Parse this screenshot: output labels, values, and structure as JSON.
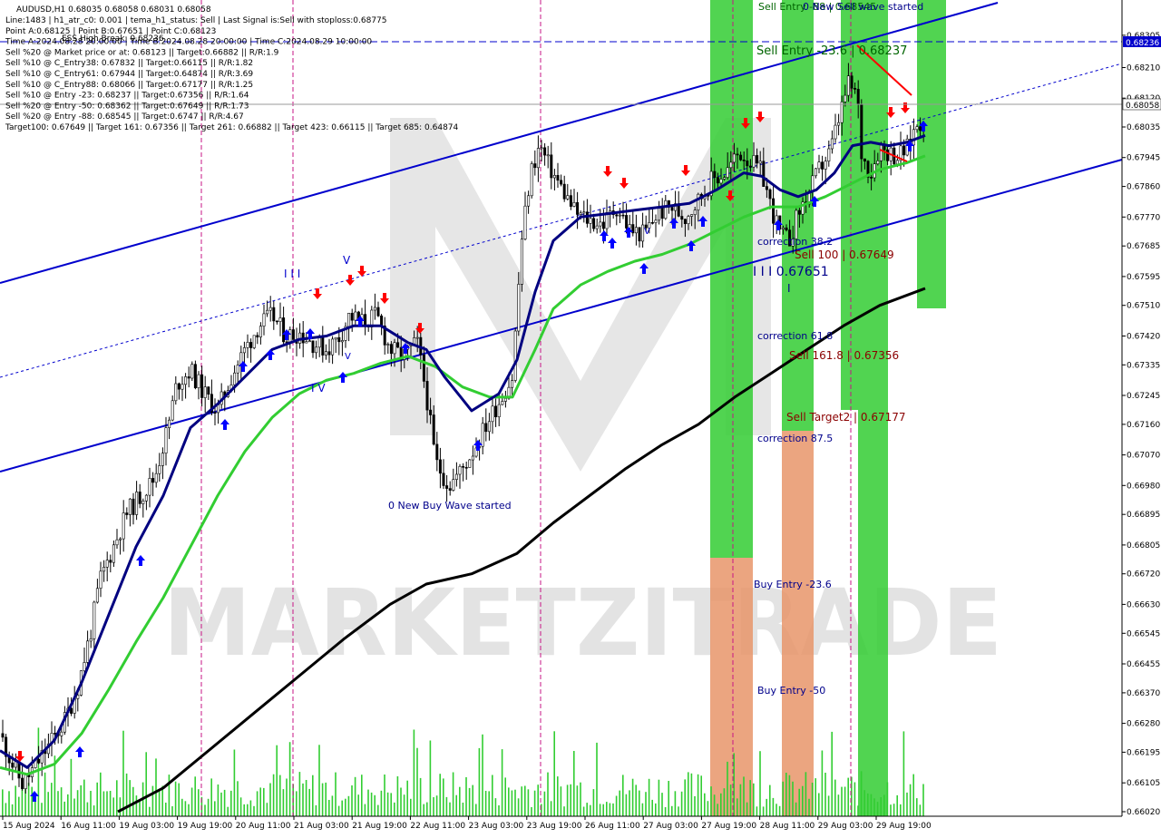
{
  "header": {
    "symbol_line": "AUDUSD,H1  0.68035 0.68058 0.68031 0.68058",
    "info_lines": [
      "Line:1483 | h1_atr_c0: 0.001 | tema_h1_status: Sell | Last Signal is:Sell with stoploss:0.68775",
      "Point A:0.68125 | Point B:0.67651 | Point C:0.68123",
      "Time A:2024.08.28 20:00:00 | Time B:2024.08.28 20:00:00 | Time C:2024.08.29 10:00:00",
      "Sell %20 @ Market price or at: 0.68123 || Target:0.66882 || R/R:1.9",
      "Sell %10 @ C_Entry38: 0.67832 || Target:0.66115 || R/R:1.82",
      "Sell %10 @ C_Entry61: 0.67944 || Target:0.64874 || R/R:3.69",
      "Sell %10 @ C_Entry88: 0.68066 || Target:0.67177 || R/R:1.25",
      "Sell %10 @ Entry -23: 0.68237 || Target:0.67356 || R/R:1.64",
      "Sell %20 @ Entry -50: 0.68362 || Target:0.67649 || R/R:1.73",
      "Sell %20 @ Entry -88: 0.68545 || Target:0.6747 || R/R:4.67",
      "Target100: 0.67649 || Target 161: 0.67356 || Target 261: 0.66882 || Target 423: 0.66115 || Target 685: 0.64874"
    ],
    "overlap_label": "ESS High Break: 0.68236"
  },
  "colors": {
    "candle": "#000000",
    "ema_fast": "#000080",
    "ema_mid": "#32cd32",
    "ema_slow": "#000000",
    "channel": "#0000cd",
    "volume": "#32cd32",
    "zone_green": "#32cd32",
    "zone_orange": "#e8956a",
    "buy_arrow": "#0000ff",
    "sell_arrow": "#ff0000",
    "price_tag": "#0000cd"
  },
  "annotations": {
    "sell_entry_top": "Sell Entry -88 | 0.68545",
    "new_sell_wave": "0 New Sell wave started",
    "sell_entry_mid": "Sell Entry -23.6 | 0.68237",
    "correction_382": "correction 38.2",
    "sell_100": "Sell 100 | 0.67649",
    "point_b": "I I I 0.67651",
    "point_b_tick": "I",
    "correction_618": "correction 61.8",
    "sell_1618": "Sell 161.8 | 0.67356",
    "sell_target2": "Sell Target2 | 0.67177",
    "correction_875": "correction 87.5",
    "buy_entry_236": "Buy Entry -23.6",
    "buy_entry_50": "Buy Entry -50",
    "new_buy_wave": "0 New Buy Wave started",
    "roman_iii": "I I I",
    "roman_v": "V",
    "roman_iv": "I V",
    "small_v": "V",
    "small_v2": "V"
  },
  "watermark": "MARKETZITRADE",
  "price_axis": {
    "current_price": "0.68058",
    "high_break_price": "0.68236",
    "ticks": [
      "0.68305",
      "0.68210",
      "0.68120",
      "0.68035",
      "0.67945",
      "0.67860",
      "0.67770",
      "0.67685",
      "0.67595",
      "0.67510",
      "0.67420",
      "0.67335",
      "0.67245",
      "0.67160",
      "0.67070",
      "0.66980",
      "0.66895",
      "0.66805",
      "0.66720",
      "0.66630",
      "0.66545",
      "0.66455",
      "0.66370",
      "0.66280",
      "0.66195",
      "0.66105",
      "0.66020"
    ]
  },
  "time_axis": {
    "labels": [
      "15 Aug 2024",
      "16 Aug 11:00",
      "19 Aug 03:00",
      "19 Aug 19:00",
      "20 Aug 11:00",
      "21 Aug 03:00",
      "21 Aug 19:00",
      "22 Aug 11:00",
      "23 Aug 03:00",
      "23 Aug 19:00",
      "26 Aug 11:00",
      "27 Aug 03:00",
      "27 Aug 19:00",
      "28 Aug 11:00",
      "29 Aug 03:00",
      "29 Aug 19:00"
    ]
  },
  "chart_data": {
    "type": "candlestick",
    "symbol": "AUDUSD",
    "timeframe": "H1",
    "ylim": [
      0.6602,
      0.6835
    ],
    "close_path": [
      [
        0,
        0.6625
      ],
      [
        12,
        0.6617
      ],
      [
        25,
        0.661
      ],
      [
        38,
        0.6615
      ],
      [
        55,
        0.6622
      ],
      [
        70,
        0.6628
      ],
      [
        85,
        0.6638
      ],
      [
        100,
        0.6655
      ],
      [
        110,
        0.667
      ],
      [
        125,
        0.668
      ],
      [
        140,
        0.669
      ],
      [
        155,
        0.6695
      ],
      [
        170,
        0.67
      ],
      [
        185,
        0.6715
      ],
      [
        195,
        0.6728
      ],
      [
        210,
        0.6732
      ],
      [
        225,
        0.6725
      ],
      [
        240,
        0.672
      ],
      [
        255,
        0.673
      ],
      [
        270,
        0.6738
      ],
      [
        285,
        0.6745
      ],
      [
        300,
        0.6748
      ],
      [
        315,
        0.6742
      ],
      [
        330,
        0.6743
      ],
      [
        345,
        0.674
      ],
      [
        360,
        0.6738
      ],
      [
        375,
        0.6742
      ],
      [
        385,
        0.6748
      ],
      [
        400,
        0.6746
      ],
      [
        415,
        0.6748
      ],
      [
        430,
        0.6738
      ],
      [
        445,
        0.6736
      ],
      [
        460,
        0.674
      ],
      [
        470,
        0.6725
      ],
      [
        480,
        0.6705
      ],
      [
        495,
        0.6698
      ],
      [
        510,
        0.6703
      ],
      [
        525,
        0.671
      ],
      [
        540,
        0.6718
      ],
      [
        555,
        0.6725
      ],
      [
        565,
        0.673
      ],
      [
        575,
        0.677
      ],
      [
        585,
        0.679
      ],
      [
        595,
        0.6798
      ],
      [
        605,
        0.6792
      ],
      [
        620,
        0.6785
      ],
      [
        635,
        0.6778
      ],
      [
        650,
        0.6776
      ],
      [
        665,
        0.6775
      ],
      [
        680,
        0.678
      ],
      [
        695,
        0.6773
      ],
      [
        710,
        0.6772
      ],
      [
        725,
        0.6778
      ],
      [
        740,
        0.678
      ],
      [
        755,
        0.6777
      ],
      [
        770,
        0.6782
      ],
      [
        785,
        0.6788
      ],
      [
        800,
        0.679
      ],
      [
        815,
        0.6796
      ],
      [
        825,
        0.6794
      ],
      [
        840,
        0.679
      ],
      [
        850,
        0.678
      ],
      [
        860,
        0.6772
      ],
      [
        870,
        0.677
      ],
      [
        880,
        0.6778
      ],
      [
        895,
        0.6786
      ],
      [
        905,
        0.6792
      ],
      [
        915,
        0.6796
      ],
      [
        925,
        0.6806
      ],
      [
        935,
        0.6816
      ],
      [
        945,
        0.6813
      ],
      [
        950,
        0.6795
      ],
      [
        960,
        0.679
      ],
      [
        970,
        0.6798
      ],
      [
        980,
        0.6796
      ],
      [
        990,
        0.6795
      ],
      [
        1000,
        0.6797
      ],
      [
        1010,
        0.6804
      ],
      [
        1020,
        0.68058
      ]
    ],
    "ema_fast": [
      [
        0,
        0.662
      ],
      [
        30,
        0.6615
      ],
      [
        60,
        0.6623
      ],
      [
        90,
        0.664
      ],
      [
        120,
        0.666
      ],
      [
        150,
        0.668
      ],
      [
        180,
        0.6695
      ],
      [
        210,
        0.6715
      ],
      [
        240,
        0.6722
      ],
      [
        270,
        0.673
      ],
      [
        300,
        0.6738
      ],
      [
        330,
        0.6741
      ],
      [
        360,
        0.6742
      ],
      [
        390,
        0.6745
      ],
      [
        420,
        0.6745
      ],
      [
        450,
        0.674
      ],
      [
        470,
        0.6738
      ],
      [
        490,
        0.673
      ],
      [
        520,
        0.672
      ],
      [
        550,
        0.6725
      ],
      [
        570,
        0.6735
      ],
      [
        590,
        0.6755
      ],
      [
        610,
        0.677
      ],
      [
        640,
        0.6777
      ],
      [
        670,
        0.6778
      ],
      [
        700,
        0.6779
      ],
      [
        730,
        0.678
      ],
      [
        760,
        0.6781
      ],
      [
        790,
        0.6785
      ],
      [
        820,
        0.679
      ],
      [
        840,
        0.6789
      ],
      [
        860,
        0.6785
      ],
      [
        880,
        0.6783
      ],
      [
        900,
        0.6785
      ],
      [
        920,
        0.679
      ],
      [
        940,
        0.6798
      ],
      [
        960,
        0.6799
      ],
      [
        980,
        0.6798
      ],
      [
        1000,
        0.6799
      ],
      [
        1020,
        0.6801
      ]
    ],
    "ema_mid": [
      [
        0,
        0.6615
      ],
      [
        30,
        0.6613
      ],
      [
        60,
        0.6616
      ],
      [
        90,
        0.6625
      ],
      [
        120,
        0.6638
      ],
      [
        150,
        0.6652
      ],
      [
        180,
        0.6665
      ],
      [
        210,
        0.668
      ],
      [
        240,
        0.6695
      ],
      [
        270,
        0.6708
      ],
      [
        300,
        0.6718
      ],
      [
        330,
        0.6725
      ],
      [
        360,
        0.6729
      ],
      [
        390,
        0.6731
      ],
      [
        420,
        0.6734
      ],
      [
        450,
        0.6736
      ],
      [
        480,
        0.6733
      ],
      [
        510,
        0.6727
      ],
      [
        540,
        0.6724
      ],
      [
        565,
        0.6724
      ],
      [
        590,
        0.6738
      ],
      [
        610,
        0.675
      ],
      [
        640,
        0.6757
      ],
      [
        670,
        0.6761
      ],
      [
        700,
        0.6764
      ],
      [
        730,
        0.6766
      ],
      [
        760,
        0.6769
      ],
      [
        790,
        0.6773
      ],
      [
        820,
        0.6777
      ],
      [
        850,
        0.678
      ],
      [
        880,
        0.678
      ],
      [
        910,
        0.6783
      ],
      [
        940,
        0.6787
      ],
      [
        970,
        0.6791
      ],
      [
        1000,
        0.6793
      ],
      [
        1020,
        0.6795
      ]
    ],
    "ema_slow": [
      [
        130,
        0.6602
      ],
      [
        180,
        0.6609
      ],
      [
        230,
        0.662
      ],
      [
        280,
        0.6631
      ],
      [
        330,
        0.6642
      ],
      [
        380,
        0.6653
      ],
      [
        430,
        0.6663
      ],
      [
        470,
        0.6669
      ],
      [
        520,
        0.6672
      ],
      [
        570,
        0.6678
      ],
      [
        610,
        0.6687
      ],
      [
        650,
        0.6695
      ],
      [
        690,
        0.6703
      ],
      [
        730,
        0.671
      ],
      [
        770,
        0.6716
      ],
      [
        810,
        0.6724
      ],
      [
        850,
        0.6731
      ],
      [
        890,
        0.6738
      ],
      [
        930,
        0.6745
      ],
      [
        970,
        0.6751
      ],
      [
        1020,
        0.6756
      ]
    ]
  }
}
